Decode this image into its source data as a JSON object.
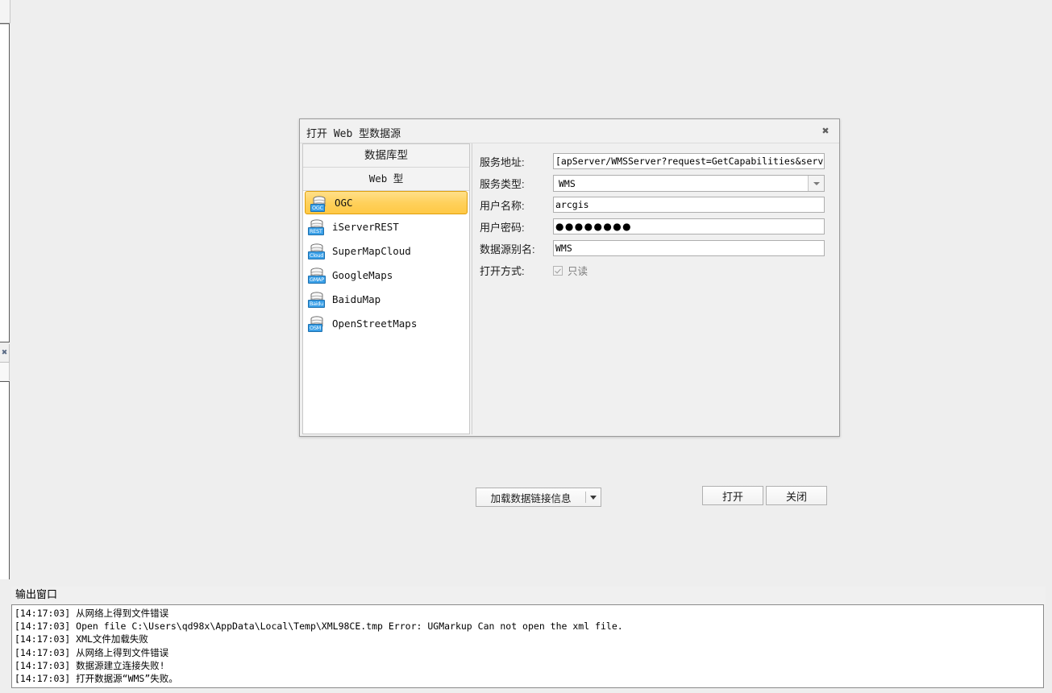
{
  "dialog": {
    "title": "打开 Web 型数据源",
    "close_icon_glyph": "✖",
    "groups": {
      "database_type": "数据库型",
      "web_type": "Web 型"
    },
    "type_list": [
      {
        "label": "OGC",
        "badge": "OGC",
        "selected": true
      },
      {
        "label": "iServerREST",
        "badge": "REST",
        "selected": false
      },
      {
        "label": "SuperMapCloud",
        "badge": "Cloud",
        "selected": false
      },
      {
        "label": "GoogleMaps",
        "badge": "GMAP",
        "selected": false
      },
      {
        "label": "BaiduMap",
        "badge": "Baidu",
        "selected": false
      },
      {
        "label": "OpenStreetMaps",
        "badge": "OSM",
        "selected": false
      }
    ],
    "form": {
      "service_address_label": "服务地址:",
      "service_address_value": "[apServer/WMSServer?request=GetCapabilities&service=WMS",
      "service_type_label": "服务类型:",
      "service_type_value": "WMS",
      "service_type_options": [
        "WMS"
      ],
      "username_label": "用户名称:",
      "username_value": "arcgis",
      "password_label": "用户密码:",
      "password_value": "●●●●●●●●",
      "alias_label": "数据源别名:",
      "alias_value": "WMS",
      "open_mode_label": "打开方式:",
      "readonly_label": "只读",
      "readonly_checked": true
    },
    "buttons": {
      "load_link_info": "加载数据链接信息",
      "open": "打开",
      "close": "关闭"
    }
  },
  "output_window": {
    "title": "输出窗口",
    "lines": [
      "[14:17:03] 从网络上得到文件错误",
      "[14:17:03] Open file C:\\Users\\qd98x\\AppData\\Local\\Temp\\XML98CE.tmp Error: UGMarkup Can not open the xml file.",
      "[14:17:03] XML文件加载失败",
      "[14:17:03] 从网络上得到文件错误",
      "[14:17:03] 数据源建立连接失败!",
      "[14:17:03] 打开数据源“WMS”失败。"
    ]
  },
  "colors": {
    "selection_gold": "#ffd15c",
    "badge_blue": "#3aa0e8",
    "window_bg": "#eeeeee"
  }
}
